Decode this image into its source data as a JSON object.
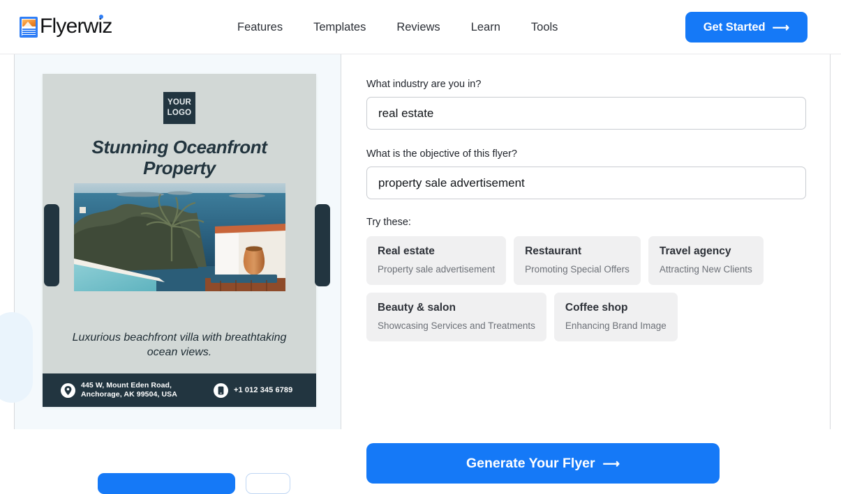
{
  "header": {
    "brand": "Flyerwiz",
    "nav": [
      {
        "label": "Features"
      },
      {
        "label": "Templates"
      },
      {
        "label": "Reviews"
      },
      {
        "label": "Learn"
      },
      {
        "label": "Tools"
      }
    ],
    "cta": {
      "label": "Get Started",
      "icon": "arrow-right-icon",
      "color": "#1579f7"
    }
  },
  "flyer": {
    "logo_placeholder_line1": "YOUR",
    "logo_placeholder_line2": "LOGO",
    "title": "Stunning Oceanfront Property",
    "subtitle": "Luxurious beachfront villa with breathtaking ocean views.",
    "address": "445 W, Mount Eden Road,\nAnchorage, AK 99504, USA",
    "phone": "+1 012 345 6789",
    "background_color": "#d2d8d6",
    "footer_color": "#223540",
    "title_color": "#22343e"
  },
  "form": {
    "industry": {
      "label": "What industry are you in?",
      "value": "real estate",
      "placeholder": "What industry are you in?"
    },
    "objective": {
      "label": "What is the objective of this flyer?",
      "value": "property sale advertisement",
      "placeholder": "What is the objective of this flyer?"
    },
    "try_these_label": "Try these:",
    "suggestions": [
      {
        "title": "Real estate",
        "subtitle": "Property sale advertisement"
      },
      {
        "title": "Restaurant",
        "subtitle": "Promoting Special Offers"
      },
      {
        "title": "Travel agency",
        "subtitle": "Attracting New Clients"
      },
      {
        "title": "Beauty & salon",
        "subtitle": "Showcasing Services and Treatments"
      },
      {
        "title": "Coffee shop",
        "subtitle": "Enhancing Brand Image"
      }
    ],
    "generate": {
      "label": "Generate Your Flyer",
      "icon": "arrow-right-icon",
      "color": "#1579f7"
    }
  }
}
